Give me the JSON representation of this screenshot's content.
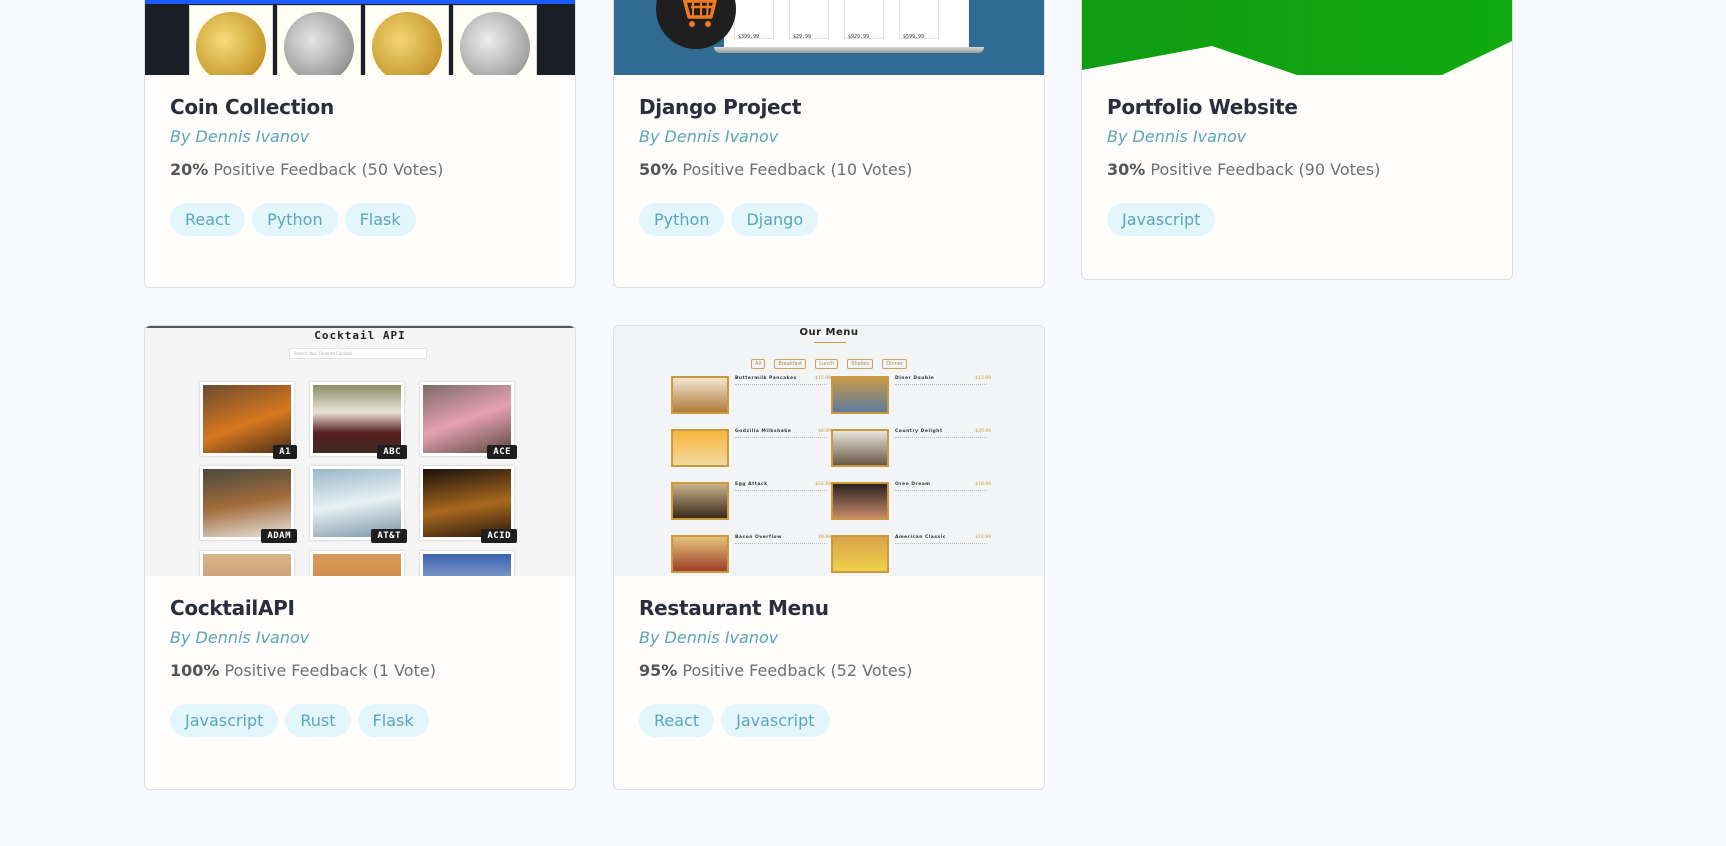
{
  "cards": [
    {
      "title": "Coin Collection",
      "author": "By Dennis Ivanov",
      "pct": "20%",
      "feedback": "Positive Feedback (50 Votes)",
      "tags": [
        "React",
        "Python",
        "Flask"
      ]
    },
    {
      "title": "Django Project",
      "author": "By Dennis Ivanov",
      "pct": "50%",
      "feedback": "Positive Feedback (10 Votes)",
      "tags": [
        "Python",
        "Django"
      ],
      "thumb": {
        "prices": [
          "$399.99",
          "$29.99",
          "$929.99",
          "$599.99"
        ]
      }
    },
    {
      "title": "Portfolio Website",
      "author": "By Dennis Ivanov",
      "pct": "30%",
      "feedback": "Positive Feedback (90 Votes)",
      "tags": [
        "Javascript"
      ]
    },
    {
      "title": "CocktailAPI",
      "author": "By Dennis Ivanov",
      "pct": "100%",
      "feedback": "Positive Feedback (1 Vote)",
      "tags": [
        "Javascript",
        "Rust",
        "Flask"
      ],
      "thumb": {
        "heading": "Cocktail API",
        "search_placeholder": "Search Your Favorite Cocktail",
        "drinks": [
          "A1",
          "ABC",
          "ACE",
          "ADAM",
          "AT&T",
          "ACID"
        ]
      }
    },
    {
      "title": "Restaurant Menu",
      "author": "By Dennis Ivanov",
      "pct": "95%",
      "feedback": "Positive Feedback (52 Votes)",
      "tags": [
        "React",
        "Javascript"
      ],
      "thumb": {
        "heading": "Our Menu",
        "categories": [
          "All",
          "Breakfast",
          "Lunch",
          "Shakes",
          "Dinner"
        ],
        "items": [
          {
            "name": "Buttermilk Pancakes",
            "price": "$15.99"
          },
          {
            "name": "Diner Double",
            "price": "$13.99"
          },
          {
            "name": "Godzilla Milkshake",
            "price": "$6.99"
          },
          {
            "name": "Country Delight",
            "price": "$20.99"
          },
          {
            "name": "Egg Attack",
            "price": "$22.99"
          },
          {
            "name": "Oreo Dream",
            "price": "$18.99"
          },
          {
            "name": "Bacon Overflow",
            "price": "$8.99"
          },
          {
            "name": "American Classic",
            "price": "$12.99"
          }
        ]
      }
    }
  ],
  "colors": {
    "accent_text": "#5aa5b8",
    "tag_bg": "#e3f6fb",
    "title": "#2a2d3a",
    "portfolio_green": "#12a512"
  }
}
